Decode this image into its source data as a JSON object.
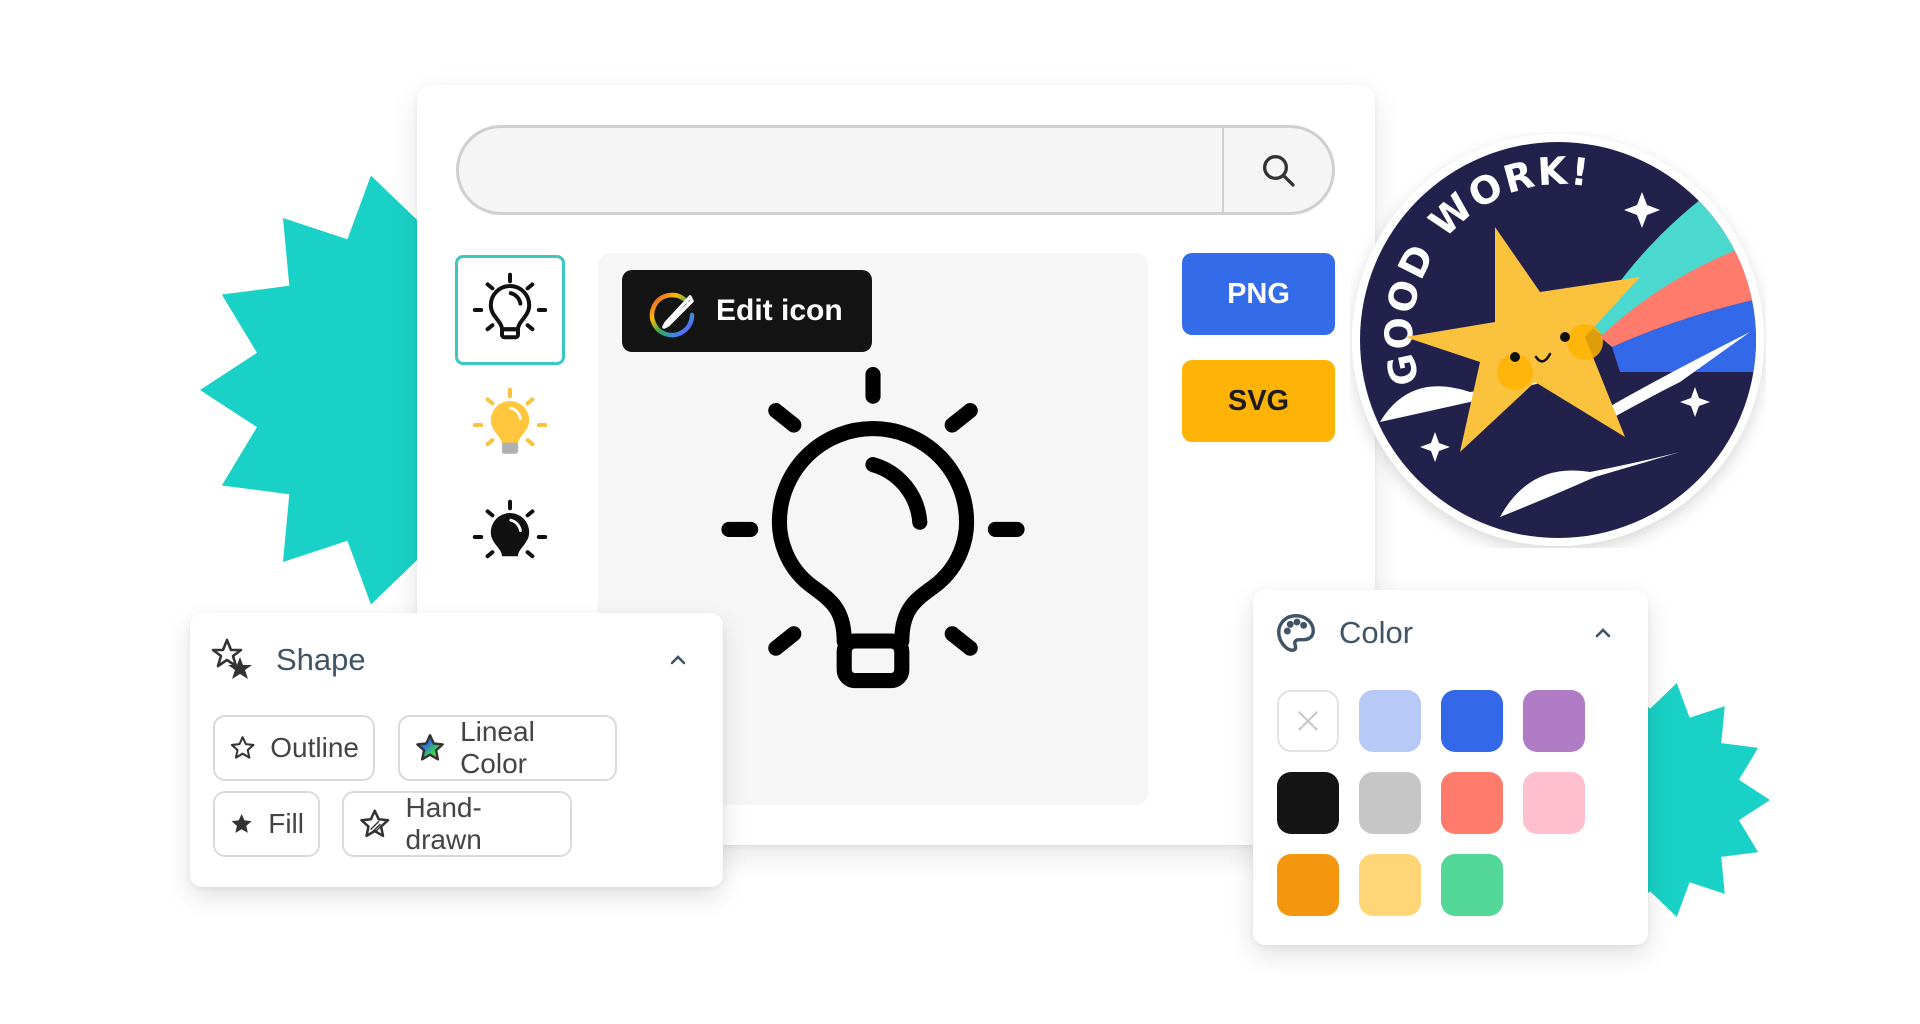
{
  "search": {
    "value": "",
    "placeholder": "",
    "button_icon": "search-icon"
  },
  "variants": [
    {
      "name": "lightbulb-outline",
      "style": "Outline",
      "selected": true
    },
    {
      "name": "lightbulb-color",
      "style": "Lineal Color",
      "selected": false
    },
    {
      "name": "lightbulb-fill",
      "style": "Fill",
      "selected": false
    }
  ],
  "preview": {
    "edit_button_label": "Edit icon",
    "edit_icon": "pencil-rainbow-ring-icon",
    "icon": "lightbulb-icon"
  },
  "downloads": {
    "png_label": "PNG",
    "svg_label": "SVG",
    "png_color": "#346be8",
    "svg_color": "#ffb305"
  },
  "badge": {
    "text": "GOOD WORK!",
    "background": "#22214c",
    "star_color": "#fbc02d"
  },
  "shape_panel": {
    "title": "Shape",
    "icon": "stars-icon",
    "collapse_icon": "chevron-up-icon",
    "options": [
      {
        "label": "Outline",
        "icon": "star-outline-icon"
      },
      {
        "label": "Lineal Color",
        "icon": "star-lineal-color-icon"
      },
      {
        "label": "Fill",
        "icon": "star-fill-icon"
      },
      {
        "label": "Hand-drawn",
        "icon": "star-hand-drawn-icon"
      }
    ]
  },
  "color_panel": {
    "title": "Color",
    "icon": "palette-icon",
    "collapse_icon": "chevron-up-icon",
    "swatches": [
      {
        "name": "none",
        "color": null
      },
      {
        "name": "light-blue",
        "color": "#b7c9f7"
      },
      {
        "name": "blue",
        "color": "#3369e8"
      },
      {
        "name": "purple",
        "color": "#b07cc6"
      },
      {
        "name": "black",
        "color": "#141414"
      },
      {
        "name": "gray",
        "color": "#c6c6c6"
      },
      {
        "name": "coral",
        "color": "#ff7b6b"
      },
      {
        "name": "pink",
        "color": "#ffbfcf"
      },
      {
        "name": "orange",
        "color": "#f4970e"
      },
      {
        "name": "light-yellow",
        "color": "#ffd577"
      },
      {
        "name": "green",
        "color": "#53d897"
      }
    ]
  },
  "decor": {
    "accent": "#19d1c6"
  }
}
